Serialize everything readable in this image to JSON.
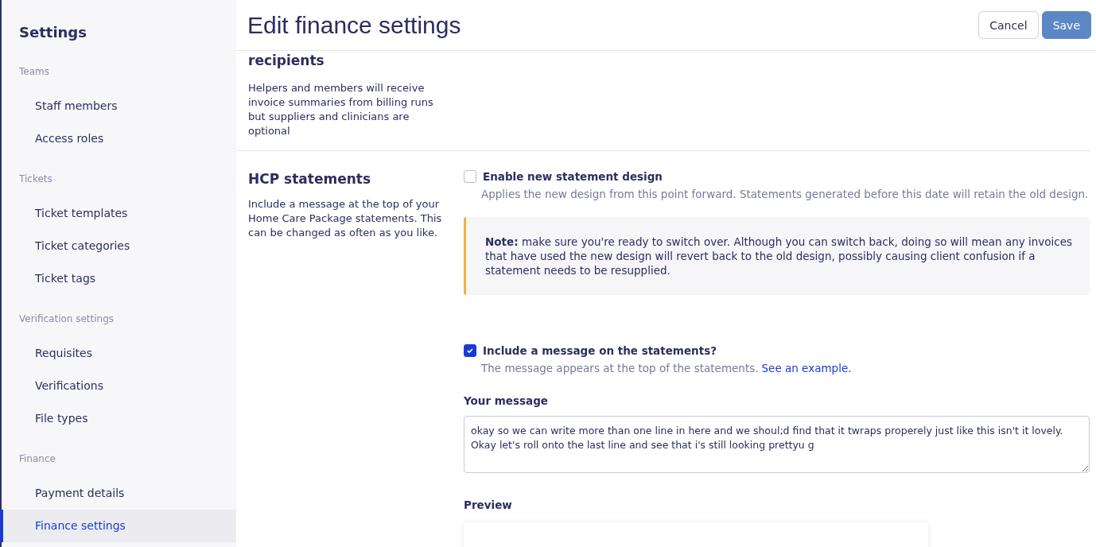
{
  "sidebar": {
    "title": "Settings",
    "groups": [
      {
        "label": "Teams",
        "items": [
          {
            "label": "Staff members",
            "selected": false
          },
          {
            "label": "Access roles",
            "selected": false
          }
        ]
      },
      {
        "label": "Tickets",
        "items": [
          {
            "label": "Ticket templates",
            "selected": false
          },
          {
            "label": "Ticket categories",
            "selected": false
          },
          {
            "label": "Ticket tags",
            "selected": false
          }
        ]
      },
      {
        "label": "Verification settings",
        "items": [
          {
            "label": "Requisites",
            "selected": false
          },
          {
            "label": "Verifications",
            "selected": false
          },
          {
            "label": "File types",
            "selected": false
          }
        ]
      },
      {
        "label": "Finance",
        "items": [
          {
            "label": "Payment details",
            "selected": false
          },
          {
            "label": "Finance settings",
            "selected": true
          }
        ]
      }
    ]
  },
  "header": {
    "title": "Edit finance settings",
    "buttons": [
      {
        "label": "Cancel",
        "kind": "secondary"
      },
      {
        "label": "Save",
        "kind": "primary"
      }
    ]
  },
  "recipients_section": {
    "title": "recipients",
    "description": "Helpers and members will receive invoice summaries from billing runs but suppliers and clinicians are optional"
  },
  "hcp_section": {
    "title": "HCP statements",
    "description": "Include a message at the top of your Home Care Package statements. This can be changed as often as you like.",
    "design_option": {
      "label": "Enable new statement design",
      "checked": false,
      "description": "Applies the new design from this point forward. Statements generated before this date will retain the old design."
    },
    "note": "**Note:** make sure you're ready to switch over. Although you can switch back, doing so will mean any invoices that have used the new design will revert back to the old design, possibly causing client confusion if a statement needs to be resupplied.",
    "message_option": {
      "label": "Include a message on the statements?",
      "checked": true,
      "description": "The message appears at the top of the statements.",
      "link": "See an example."
    },
    "message_field": {
      "label": "Your message",
      "value": "okay so we can write more than one line in here and we shoul;d find that it twraps properely just like this isn't it lovely. Okay let's roll onto the last line and see that i's still looking prettyu g"
    },
    "preview": {
      "label": "Preview"
    }
  }
}
